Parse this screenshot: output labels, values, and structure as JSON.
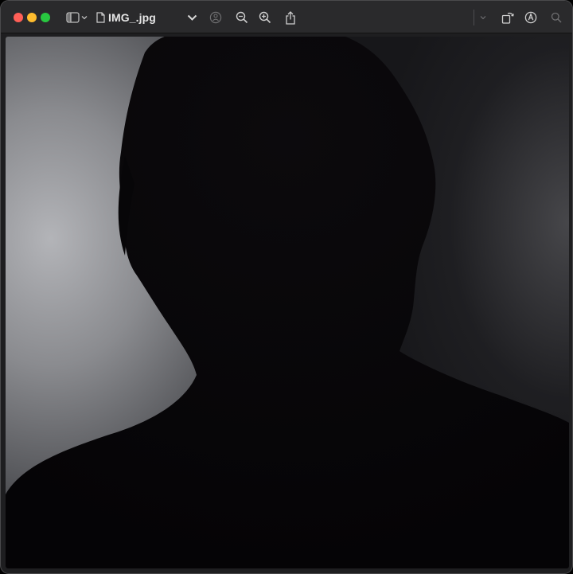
{
  "window": {
    "title": "IMG_.jpg"
  },
  "toolbar": {
    "icons": [
      "sidebar-icon",
      "chevron-down-icon",
      "document-icon",
      "title-chevron-icon",
      "person-icon",
      "zoom-out-icon",
      "zoom-in-icon",
      "share-icon",
      "rotate-icon",
      "markup-icon",
      "search-icon"
    ]
  },
  "colors": {
    "close": "#ff5f57",
    "minimize": "#febc2e",
    "zoom": "#28c840",
    "titlebar": "#2a2a2c"
  }
}
